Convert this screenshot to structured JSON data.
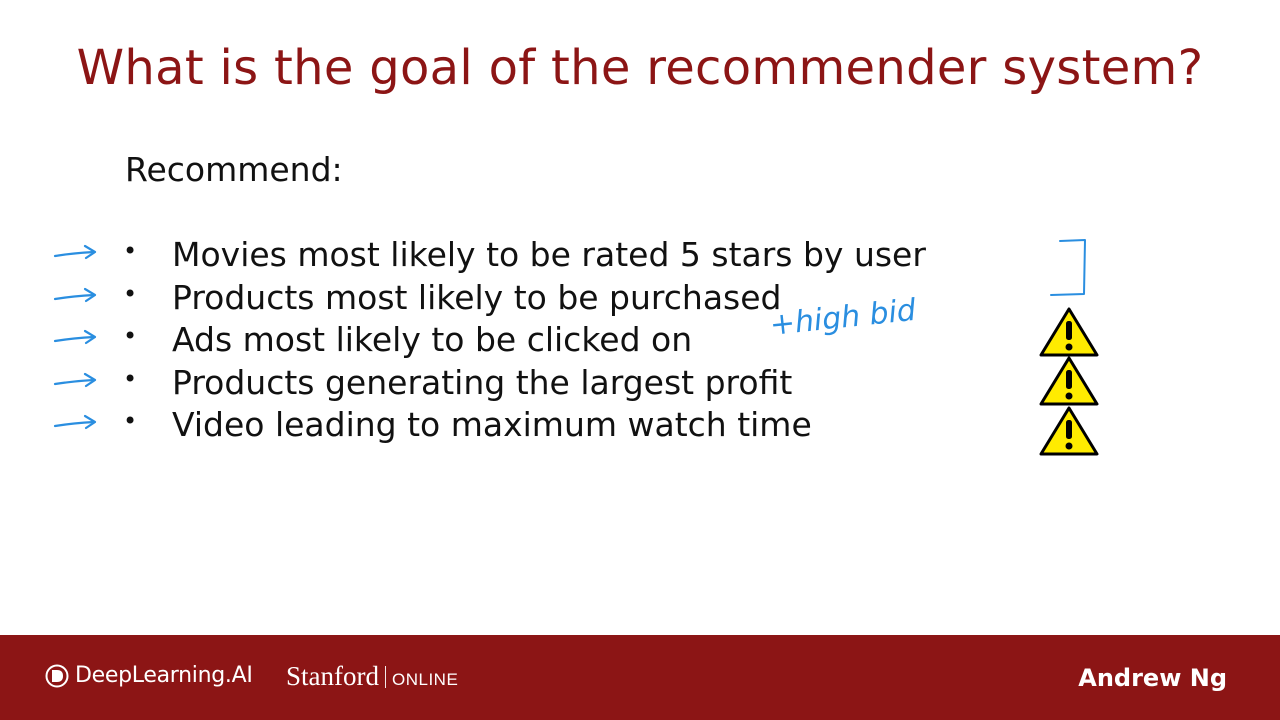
{
  "slide": {
    "title": "What is the goal of the recommender system?",
    "heading": "Recommend:",
    "bullets": [
      "Movies most likely to be rated 5 stars by user",
      "Products most likely to be purchased",
      "Ads most likely to be clicked on",
      "Products generating the largest profit",
      "Video leading to maximum watch time"
    ],
    "bullet_glyph": "•",
    "handwritten_note": "+high bid"
  },
  "footer": {
    "deeplearning_logo": "DeepLearning.AI",
    "stanford_logo": "Stanford",
    "online_label": "ONLINE",
    "author": "Andrew Ng"
  },
  "colors": {
    "title": "#8c1515",
    "footer_bg": "#8c1515",
    "annotation": "#2a8ee0",
    "warning_fill": "#ffeb00"
  },
  "icons": [
    "arrow-annotation-icon",
    "bracket-annotation",
    "warning-icon",
    "deeplearning-logo-icon"
  ]
}
